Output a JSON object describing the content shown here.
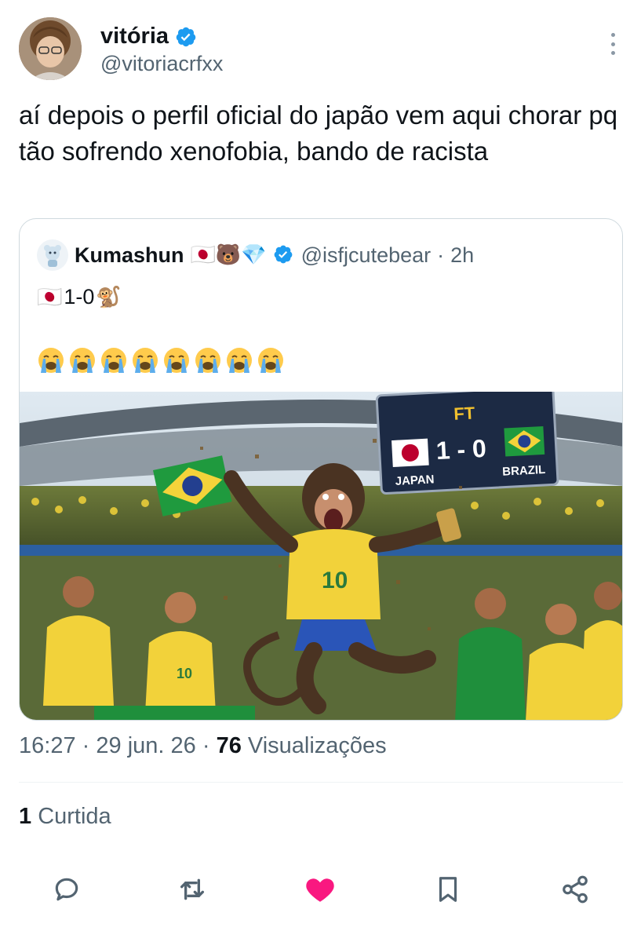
{
  "author": {
    "display_name": "vitória",
    "handle": "@vitoriacrfxx",
    "verified": true
  },
  "tweet_text": "aí depois o perfil oficial do japão vem aqui chorar pq tão sofrendo xenofobia, bando de racista",
  "quoted": {
    "display_name": "Kumashun",
    "name_emojis": "🇯🇵🐻💎",
    "handle": "@isfjcutebear",
    "separator": "·",
    "time": "2h",
    "line1_flag": "🇯🇵",
    "line1_score": "1-0",
    "line1_emoji": "🐒",
    "crying_count": 8,
    "image": {
      "scoreboard_ft": "FT",
      "scoreboard_score": "1 - 0",
      "team_left": "JAPAN",
      "team_right": "BRAZIL",
      "jersey_number": "10"
    }
  },
  "meta": {
    "time": "16:27",
    "sep1": "·",
    "date": "29 jun. 26",
    "sep2": "·",
    "views_count": "76",
    "views_label": "Visualizações"
  },
  "likes": {
    "count": "1",
    "label": "Curtida"
  },
  "colors": {
    "verified": "#1d9bf0",
    "heart": "#f91880",
    "secondary_text": "#536471",
    "icon": "#536471"
  },
  "icons": {
    "reply": "reply-icon",
    "retweet": "retweet-icon",
    "like": "heart-icon",
    "bookmark": "bookmark-icon",
    "share": "share-icon"
  }
}
